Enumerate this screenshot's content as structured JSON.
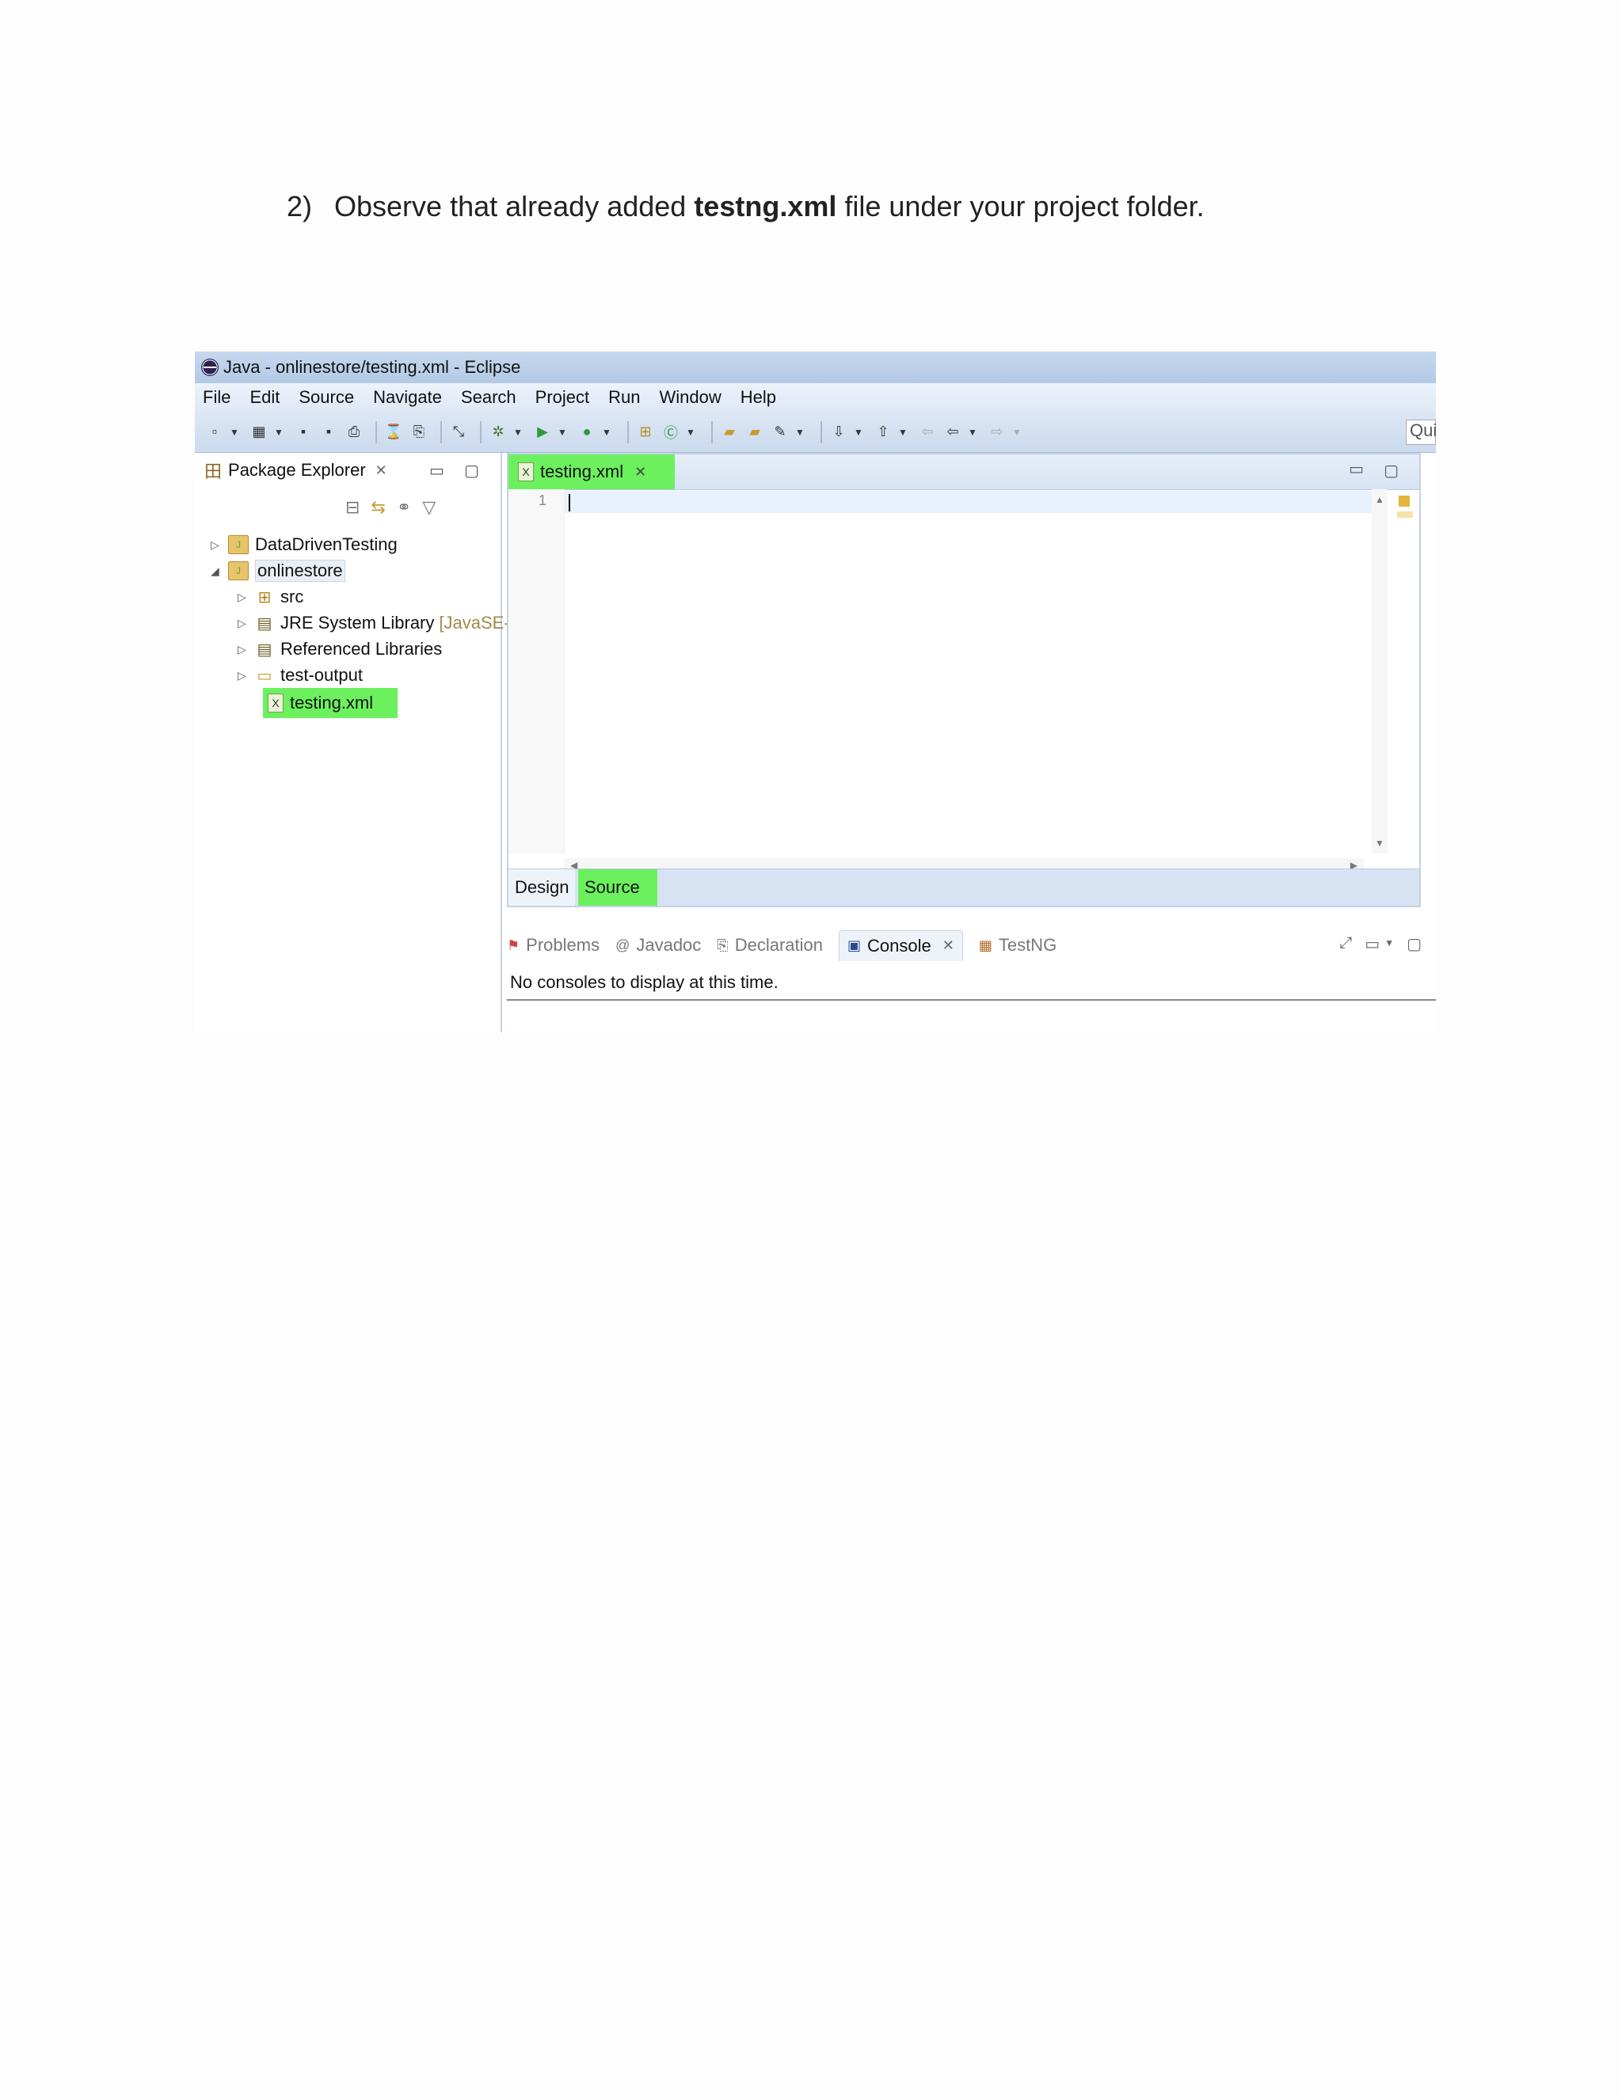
{
  "instruction": {
    "prefix": "2)  Observe that already added ",
    "bold": "testng.xml",
    "suffix": " file under your project folder."
  },
  "window": {
    "title": "Java - onlinestore/testing.xml - Eclipse",
    "menu": [
      "File",
      "Edit",
      "Source",
      "Navigate",
      "Search",
      "Project",
      "Run",
      "Window",
      "Help"
    ],
    "quick_access": "Qui"
  },
  "package_explorer": {
    "title": "Package Explorer",
    "tree": [
      {
        "label": "DataDrivenTesting",
        "suffix": ""
      },
      {
        "label": "onlinestore",
        "suffix": ""
      },
      {
        "label": "src",
        "suffix": ""
      },
      {
        "label": "JRE System Library",
        "suffix": "[JavaSE-"
      },
      {
        "label": "Referenced Libraries",
        "suffix": ""
      },
      {
        "label": "test-output",
        "suffix": ""
      },
      {
        "label": "testing.xml",
        "suffix": ""
      }
    ]
  },
  "editor": {
    "tab_label": "testing.xml",
    "line_number": "1",
    "bottom_tabs": [
      "Design",
      "Source"
    ]
  },
  "bottom_panel": {
    "tabs": [
      "Problems",
      "Javadoc",
      "Declaration",
      "Console",
      "TestNG"
    ],
    "message": "No consoles to display at this time."
  },
  "colors": {
    "highlight": "#6cf05e",
    "eclipse_blue": "#c6d8ee"
  }
}
